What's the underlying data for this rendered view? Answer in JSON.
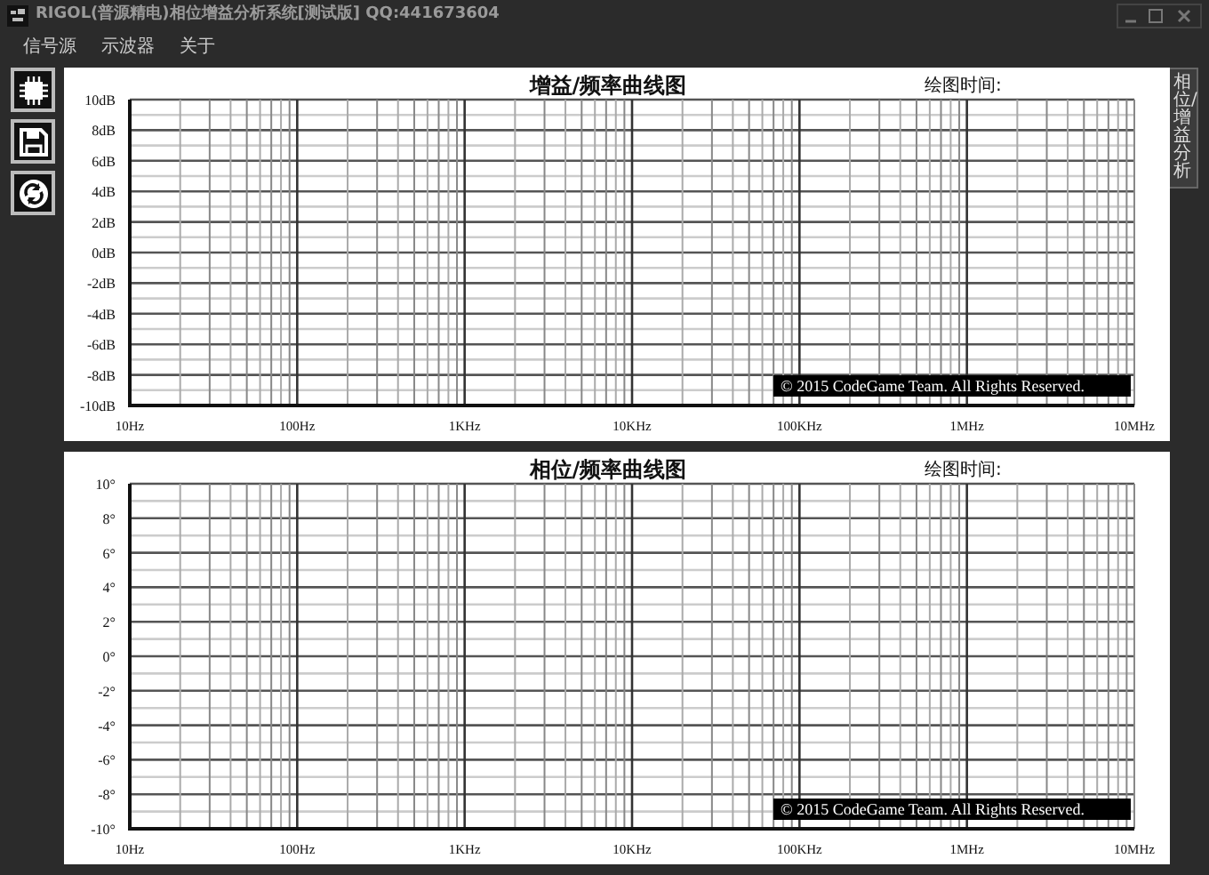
{
  "window": {
    "title": "RIGOL(普源精电)相位增益分析系统[测试版] QQ:441673604"
  },
  "menu": [
    {
      "label": "信号源"
    },
    {
      "label": "示波器"
    },
    {
      "label": "关于"
    }
  ],
  "toolbar": [
    {
      "kind": "chip"
    },
    {
      "kind": "save"
    },
    {
      "kind": "refresh"
    }
  ],
  "charts": [
    {
      "time_label": "绘图时间:",
      "copyright": "© 2015 CodeGame Team. All Rights Reserved.",
      "chart_data": {
        "type": "line",
        "title": "增益/频率曲线图",
        "grid": true,
        "ylim": [
          -10,
          10
        ],
        "categories": [
          "10Hz",
          "100Hz",
          "1KHz",
          "10KHz",
          "100KHz",
          "1MHz",
          "10MHz"
        ],
        "yticks": [
          {
            "value": 10,
            "label": "10dB"
          },
          {
            "value": 8,
            "label": "8dB"
          },
          {
            "value": 6,
            "label": "6dB"
          },
          {
            "value": 4,
            "label": "4dB"
          },
          {
            "value": 2,
            "label": "2dB"
          },
          {
            "value": 0,
            "label": "0dB"
          },
          {
            "value": -2,
            "label": "-2dB"
          },
          {
            "value": -4,
            "label": "-4dB"
          },
          {
            "value": -6,
            "label": "-6dB"
          },
          {
            "value": -8,
            "label": "-8dB"
          },
          {
            "value": -10,
            "label": "-10dB"
          }
        ]
      }
    },
    {
      "time_label": "绘图时间:",
      "copyright": "© 2015 CodeGame Team. All Rights Reserved.",
      "chart_data": {
        "type": "line",
        "title": "相位/频率曲线图",
        "grid": true,
        "ylim": [
          -10,
          10
        ],
        "categories": [
          "10Hz",
          "100Hz",
          "1KHz",
          "10KHz",
          "100KHz",
          "1MHz",
          "10MHz"
        ],
        "yticks": [
          {
            "value": 10,
            "label": "10°"
          },
          {
            "value": 8,
            "label": "8°"
          },
          {
            "value": 6,
            "label": "6°"
          },
          {
            "value": 4,
            "label": "4°"
          },
          {
            "value": 2,
            "label": "2°"
          },
          {
            "value": 0,
            "label": "0°"
          },
          {
            "value": -2,
            "label": "-2°"
          },
          {
            "value": -4,
            "label": "-4°"
          },
          {
            "value": -6,
            "label": "-6°"
          },
          {
            "value": -8,
            "label": "-8°"
          },
          {
            "value": -10,
            "label": "-10°"
          }
        ]
      }
    }
  ],
  "side_tab": {
    "label": "相位/增益分析",
    "selected": true
  }
}
